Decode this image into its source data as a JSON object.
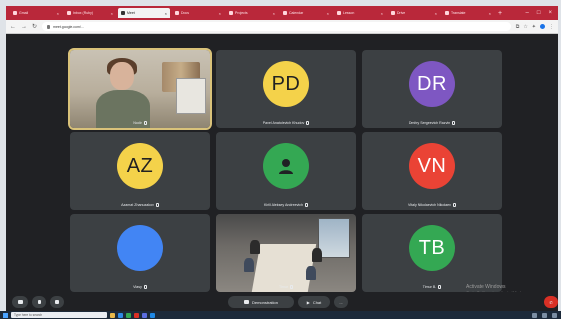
{
  "browser": {
    "tabs": [
      {
        "label": "Gmail",
        "active": false
      },
      {
        "label": "Inbox (Ruby)",
        "active": false
      },
      {
        "label": "Meet",
        "active": true
      },
      {
        "label": "Docs",
        "active": false
      },
      {
        "label": "Projects",
        "active": false
      },
      {
        "label": "Calendar",
        "active": false
      },
      {
        "label": "Lesson",
        "active": false
      },
      {
        "label": "Drive",
        "active": false
      },
      {
        "label": "Translate",
        "active": false
      }
    ],
    "url": "meet.google.com/..."
  },
  "meeting": {
    "participants": [
      {
        "name": "Nodir",
        "initials": "",
        "color": "",
        "type": "camera"
      },
      {
        "name": "Pavel Anatolevich Khudov",
        "initials": "PD",
        "color": "#f4d24a"
      },
      {
        "name": "Dmitry Sergeevich Razvin",
        "initials": "DR",
        "color": "#7e57c2"
      },
      {
        "name": "Azamat Zhanuzakov",
        "initials": "AZ",
        "color": "#f4d24a"
      },
      {
        "name": "Kirill Aleksey Andreevich",
        "initials": "",
        "color": "#34a853",
        "type": "icon"
      },
      {
        "name": "Vitaly Nikolaevich Nikolaev",
        "initials": "VN",
        "color": "#ea4335"
      },
      {
        "name": "Vlasy",
        "initials": "",
        "color": "#4285f4"
      },
      {
        "name": "Timur",
        "initials": "",
        "color": "",
        "type": "room"
      },
      {
        "name": "Timur B.",
        "initials": "TB",
        "color": "#34a853"
      }
    ]
  },
  "controls": {
    "present_label": "Demonstration",
    "chat_label": "Chat",
    "more_label": "..."
  },
  "watermark": {
    "title": "Activate Windows",
    "subtitle": "Go to Settings to activate Windows."
  },
  "taskbar": {
    "search_placeholder": "Type here to search"
  }
}
